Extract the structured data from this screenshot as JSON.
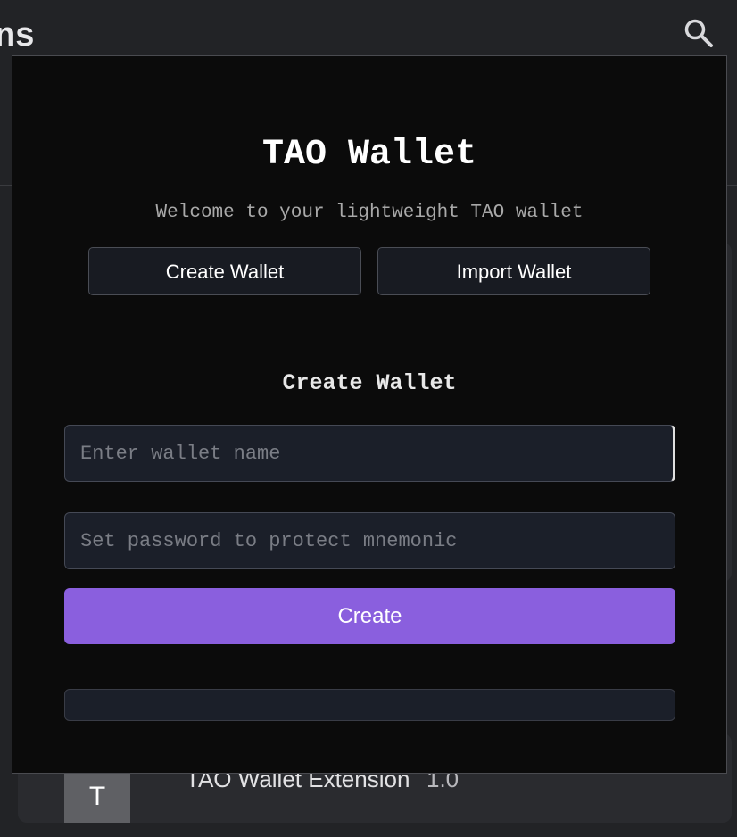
{
  "background": {
    "title_fragment": "ns",
    "search_icon": "search-icon",
    "extension": {
      "avatar_letter": "T",
      "name": "TAO Wallet Extension",
      "version": "1.0"
    }
  },
  "popup": {
    "title": "TAO Wallet",
    "subtitle": "Welcome to your lightweight TAO wallet",
    "tabs": {
      "create_label": "Create Wallet",
      "import_label": "Import Wallet"
    },
    "create_section": {
      "title": "Create Wallet",
      "wallet_name": {
        "value": "",
        "placeholder": "Enter wallet name"
      },
      "password": {
        "value": "",
        "placeholder": "Set password to protect mnemonic"
      },
      "create_button_label": "Create",
      "output_text": ""
    }
  },
  "colors": {
    "accent": "#8a5fde",
    "popup_background": "#0b0b0b",
    "page_background": "#222326",
    "field_background": "#1b1f29"
  }
}
